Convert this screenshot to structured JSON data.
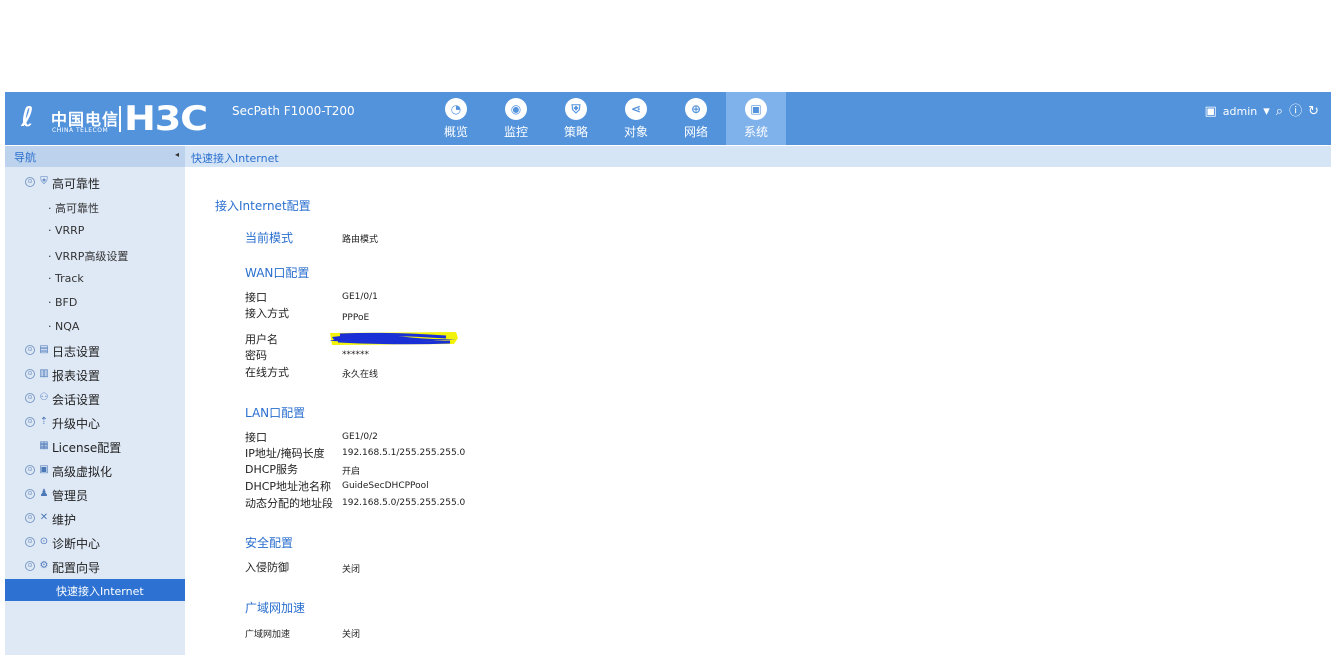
{
  "header": {
    "logo_cn": "中国电信",
    "logo_en": "CHINA TELECOM",
    "brand": "H3C",
    "product": "SecPath F1000-T200",
    "nav": [
      {
        "label": "概览",
        "icon": "dashboard-icon",
        "glyph": "◔"
      },
      {
        "label": "监控",
        "icon": "monitor-icon",
        "glyph": "◉"
      },
      {
        "label": "策略",
        "icon": "shield-icon",
        "glyph": "⛨"
      },
      {
        "label": "对象",
        "icon": "share-icon",
        "glyph": "⋖"
      },
      {
        "label": "网络",
        "icon": "globe-icon",
        "glyph": "⊕"
      },
      {
        "label": "系统",
        "icon": "system-icon",
        "glyph": "▣"
      }
    ],
    "active_nav": "系统",
    "user": "admin",
    "colors": {
      "header_bg": "#5393dc",
      "active_tab": "#7fb1ea",
      "sidebar_bg": "#dfe9f6",
      "sidebar_active": "#2d72d2",
      "link_blue": "#2a6fcf"
    }
  },
  "sidebar": {
    "header": "导航",
    "items": [
      {
        "label": "高可靠性",
        "type": "category",
        "icon": "shield-icon",
        "glyph": "⛨"
      },
      {
        "label": "· 高可靠性",
        "type": "sub"
      },
      {
        "label": "· VRRP",
        "type": "sub"
      },
      {
        "label": "· VRRP高级设置",
        "type": "sub"
      },
      {
        "label": "· Track",
        "type": "sub"
      },
      {
        "label": "· BFD",
        "type": "sub"
      },
      {
        "label": "· NQA",
        "type": "sub"
      },
      {
        "label": "日志设置",
        "type": "category",
        "icon": "log-icon",
        "glyph": "▤"
      },
      {
        "label": "报表设置",
        "type": "category",
        "icon": "report-icon",
        "glyph": "▥"
      },
      {
        "label": "会话设置",
        "type": "category",
        "icon": "session-icon",
        "glyph": "⚇"
      },
      {
        "label": "升级中心",
        "type": "category",
        "icon": "upload-icon",
        "glyph": "⇡"
      },
      {
        "label": "License配置",
        "type": "leaf",
        "icon": "license-icon",
        "glyph": "▦"
      },
      {
        "label": "高级虚拟化",
        "type": "category",
        "icon": "virtualization-icon",
        "glyph": "▣"
      },
      {
        "label": "管理员",
        "type": "category",
        "icon": "user-icon",
        "glyph": "♟"
      },
      {
        "label": "维护",
        "type": "category",
        "icon": "tools-icon",
        "glyph": "✕"
      },
      {
        "label": "诊断中心",
        "type": "category",
        "icon": "diagnosis-icon",
        "glyph": "⊙"
      },
      {
        "label": "配置向导",
        "type": "category",
        "icon": "wizard-icon",
        "glyph": "⚙"
      },
      {
        "label": "快速接入Internet",
        "type": "active"
      }
    ]
  },
  "breadcrumb": "快速接入Internet",
  "main": {
    "title": "接入Internet配置",
    "current_mode_label": "当前模式",
    "current_mode_value": "路由模式",
    "wan": {
      "title": "WAN口配置",
      "rows": [
        {
          "label": "接口",
          "value": "GE1/0/1"
        },
        {
          "label": "接入方式",
          "value": "PPPoE"
        },
        {
          "label": "用户名",
          "value": ""
        },
        {
          "label": "密码",
          "value": "******"
        },
        {
          "label": "在线方式",
          "value": "永久在线"
        }
      ]
    },
    "lan": {
      "title": "LAN口配置",
      "rows": [
        {
          "label": "接口",
          "value": "GE1/0/2"
        },
        {
          "label": "IP地址/掩码长度",
          "value": "192.168.5.1/255.255.255.0"
        },
        {
          "label": "DHCP服务",
          "value": "开启"
        },
        {
          "label": "DHCP地址池名称",
          "value": "GuideSecDHCPPool"
        },
        {
          "label": "动态分配的地址段",
          "value": "192.168.5.0/255.255.255.0"
        }
      ]
    },
    "security": {
      "title": "安全配置",
      "rows": [
        {
          "label": "入侵防御",
          "value": "关闭"
        }
      ]
    },
    "wan_accel": {
      "title": "广域网加速",
      "rows": [
        {
          "label": "广域网加速",
          "value": "关闭"
        }
      ]
    }
  }
}
